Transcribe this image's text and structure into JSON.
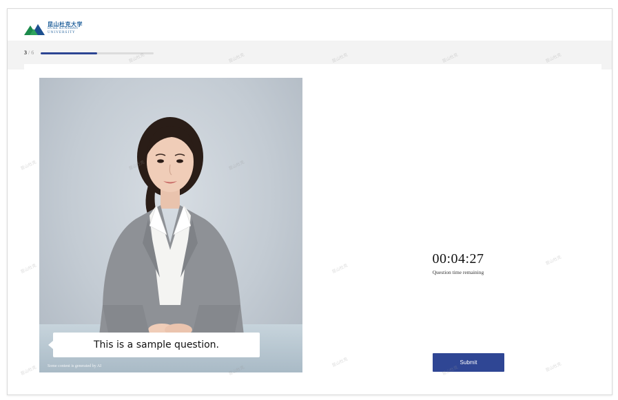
{
  "header": {
    "logo": {
      "name_cn": "昆山杜克大学",
      "name_en_line1": "DUKE KUNSHAN",
      "name_en_line2": "UNIVERSITY",
      "icon": "mountain-logo-icon"
    }
  },
  "progress": {
    "current": "3",
    "separator": "/",
    "total": "6",
    "fraction": 0.5,
    "fill_color": "#2c4593"
  },
  "video": {
    "caption": "This is a sample question.",
    "ai_note": "Some content is generated by AI"
  },
  "timer": {
    "value": "00:04:27",
    "label": "Question time remaining"
  },
  "actions": {
    "submit_label": "Submit",
    "accent_color": "#2f4694"
  },
  "watermark_text": "昆山杜克"
}
